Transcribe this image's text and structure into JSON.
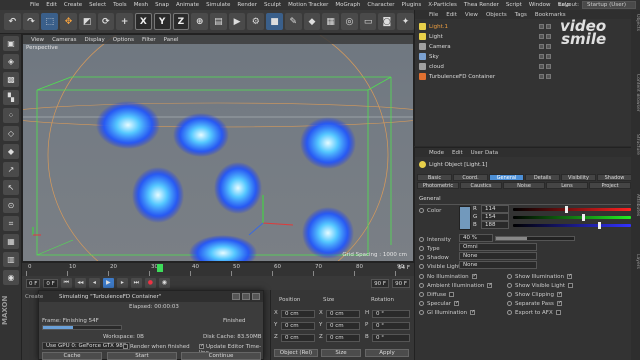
{
  "menu": [
    "File",
    "Edit",
    "Create",
    "Select",
    "Tools",
    "Mesh",
    "Snap",
    "Animate",
    "Simulate",
    "Render",
    "Sculpt",
    "Motion Tracker",
    "MoGraph",
    "Character",
    "Plugins",
    "X-Particles",
    "Thea Render",
    "Script",
    "Window",
    "Help"
  ],
  "layout": {
    "label": "Layout:",
    "value": "Startup (User)"
  },
  "toolbar": {
    "x": "X",
    "y": "Y",
    "z": "Z"
  },
  "viewport": {
    "menu": [
      "View",
      "Cameras",
      "Display",
      "Options",
      "Filter",
      "Panel"
    ],
    "label": "Perspective",
    "grid_spacing": "Grid Spacing : 1000 cm"
  },
  "timeline": {
    "ticks": [
      "0",
      "10",
      "20",
      "30",
      "40",
      "50",
      "60",
      "70",
      "80",
      "90"
    ],
    "end_frame": "54 F",
    "current_frame": "0 F",
    "field2": "0 F",
    "field3": "90 F",
    "field4": "90 F"
  },
  "sim_dialog": {
    "tab": "Create",
    "title": "Simulating \"TurbulenceFD Container\"",
    "frame": "Frame: Finishing 54F",
    "elapsed": "Elapsed: 00:00:03",
    "finished": "Finished",
    "workspace": "Workspace: 0B",
    "disk_cache": "Disk Cache: 83.50MB",
    "gpu": "Use GPU 0: GeForce GTX 980",
    "render_when_finished": "Render when finished",
    "update_editor": "Update Editor Time-line",
    "cache": "Cache",
    "start": "Start",
    "continue": "Continue",
    "progress": 0.38
  },
  "coords": {
    "headers": [
      "Position",
      "Size",
      "Rotation"
    ],
    "rows": [
      {
        "axis": "X",
        "pos": "0 cm",
        "size_axis": "X",
        "size": "0 cm",
        "rot_axis": "H",
        "rot": "0 °"
      },
      {
        "axis": "Y",
        "pos": "0 cm",
        "size_axis": "Y",
        "size": "0 cm",
        "rot_axis": "P",
        "rot": "0 °"
      },
      {
        "axis": "Z",
        "pos": "0 cm",
        "size_axis": "Z",
        "size": "0 cm",
        "rot_axis": "B",
        "rot": "0 °"
      }
    ],
    "mode": "Object (Rel)",
    "size_mode": "Size",
    "apply": "Apply"
  },
  "object_manager": {
    "menu": [
      "File",
      "Edit",
      "View",
      "Objects",
      "Tags",
      "Bookmarks"
    ],
    "objects": [
      {
        "name": "Light.1",
        "color": "#e8d04a",
        "icon": "light-icon"
      },
      {
        "name": "Light",
        "color": "#e8d04a",
        "icon": "light-icon"
      },
      {
        "name": "Camera",
        "color": "#a0a0a0",
        "icon": "camera-icon"
      },
      {
        "name": "Sky",
        "color": "#7aa0d0",
        "icon": "sky-icon"
      },
      {
        "name": "cloud",
        "color": "#a0a0a0",
        "icon": "null-icon"
      },
      {
        "name": "TurbulenceFD Container",
        "color": "#e07030",
        "icon": "container-icon"
      }
    ]
  },
  "attribute_manager": {
    "menu": [
      "Mode",
      "Edit",
      "User Data"
    ],
    "object_title": "Light Object [Light.1]",
    "tabs_row1": [
      "Basic",
      "Coord.",
      "General",
      "Details",
      "Visibility",
      "Shadow"
    ],
    "tabs_row2": [
      "Photometric",
      "Caustics",
      "Noise",
      "Lens",
      "Project"
    ],
    "active_tab": "General",
    "section": "General",
    "color_label": "Color",
    "r": "114",
    "g": "154",
    "b": "188",
    "r_level": 0.45,
    "g_level": 0.6,
    "b_level": 0.74,
    "intensity_label": "Intensity",
    "intensity": "40 %",
    "intensity_level": 0.4,
    "type_label": "Type",
    "type_value": "Omni",
    "shadow_label": "Shadow",
    "shadow_value": "None",
    "visible_label": "Visible Light",
    "visible_value": "None",
    "checks_left": [
      "No Illumination",
      "Ambient Illumination",
      "Diffuse",
      "Specular",
      "GI Illumination"
    ],
    "checks_right": [
      "Show Illumination",
      "Show Visible Light",
      "Show Clipping",
      "Separate Pass",
      "Export to AFX"
    ],
    "accent": "#4c8fd6"
  },
  "right_tabs": [
    "Objects",
    "Content Browser",
    "Structure",
    "Attributes",
    "Layers"
  ],
  "watermark": {
    "line1": "video",
    "line2": "smile"
  }
}
